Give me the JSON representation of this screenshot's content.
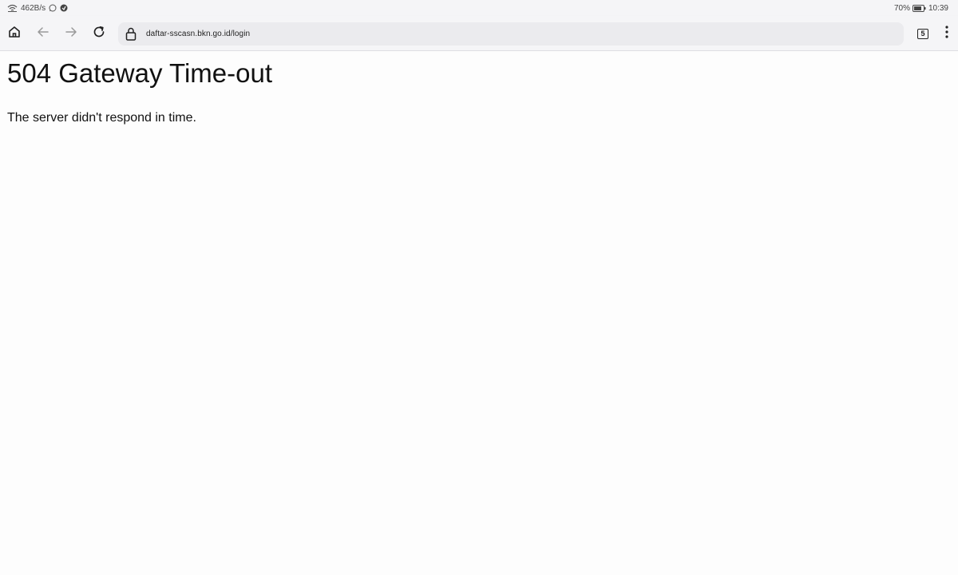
{
  "status_bar": {
    "network_speed": "462B/s",
    "battery": "70%",
    "time": "10:39",
    "icons": [
      "wifi-icon",
      "whatsapp-icon",
      "notification-icon",
      "battery-icon"
    ]
  },
  "toolbar": {
    "icons": [
      "home-icon",
      "back-icon",
      "forward-icon",
      "reload-icon",
      "lock-icon",
      "tabs-icon",
      "more-icon"
    ],
    "url": "daftar-sscasn.bkn.go.id/login",
    "tab_count": "5"
  },
  "page": {
    "title": "504 Gateway Time-out",
    "message": "The server didn't respond in time."
  }
}
